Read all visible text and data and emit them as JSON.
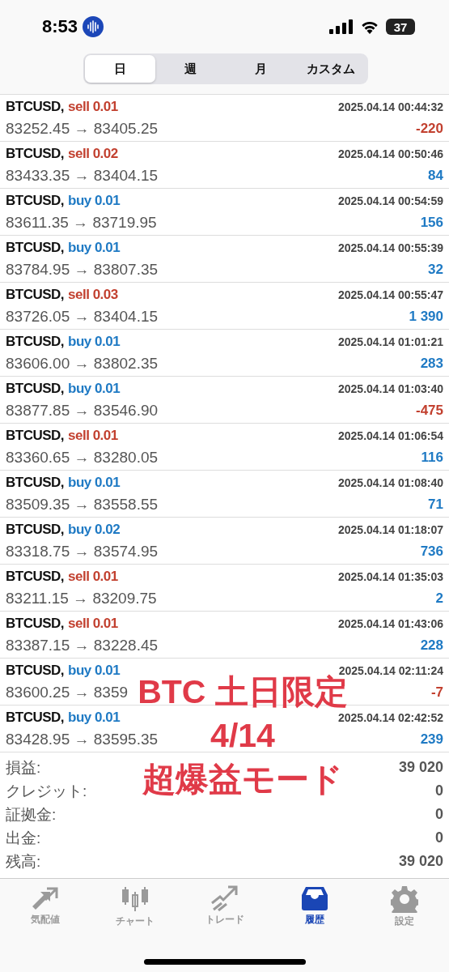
{
  "status_bar": {
    "time": "8:53",
    "battery": "37"
  },
  "period_tabs": [
    {
      "label": "日",
      "selected": true
    },
    {
      "label": "週",
      "selected": false
    },
    {
      "label": "月",
      "selected": false
    },
    {
      "label": "カスタム",
      "selected": false
    }
  ],
  "deals": [
    {
      "symbol": "BTCUSD,",
      "sell": true,
      "order": "sell 0.01",
      "time": "2025.04.14 00:44:32",
      "prices": "83252.45 → 83405.25",
      "loss": true,
      "profit": "-220"
    },
    {
      "symbol": "BTCUSD,",
      "sell": true,
      "order": "sell 0.02",
      "time": "2025.04.14 00:50:46",
      "prices": "83433.35 → 83404.15",
      "loss": false,
      "profit": "84"
    },
    {
      "symbol": "BTCUSD,",
      "sell": false,
      "order": "buy 0.01",
      "time": "2025.04.14 00:54:59",
      "prices": "83611.35 → 83719.95",
      "loss": false,
      "profit": "156"
    },
    {
      "symbol": "BTCUSD,",
      "sell": false,
      "order": "buy 0.01",
      "time": "2025.04.14 00:55:39",
      "prices": "83784.95 → 83807.35",
      "loss": false,
      "profit": "32"
    },
    {
      "symbol": "BTCUSD,",
      "sell": true,
      "order": "sell 0.03",
      "time": "2025.04.14 00:55:47",
      "prices": "83726.05 → 83404.15",
      "loss": false,
      "profit": "1 390"
    },
    {
      "symbol": "BTCUSD,",
      "sell": false,
      "order": "buy 0.01",
      "time": "2025.04.14 01:01:21",
      "prices": "83606.00 → 83802.35",
      "loss": false,
      "profit": "283"
    },
    {
      "symbol": "BTCUSD,",
      "sell": false,
      "order": "buy 0.01",
      "time": "2025.04.14 01:03:40",
      "prices": "83877.85 → 83546.90",
      "loss": true,
      "profit": "-475"
    },
    {
      "symbol": "BTCUSD,",
      "sell": true,
      "order": "sell 0.01",
      "time": "2025.04.14 01:06:54",
      "prices": "83360.65 → 83280.05",
      "loss": false,
      "profit": "116"
    },
    {
      "symbol": "BTCUSD,",
      "sell": false,
      "order": "buy 0.01",
      "time": "2025.04.14 01:08:40",
      "prices": "83509.35 → 83558.55",
      "loss": false,
      "profit": "71"
    },
    {
      "symbol": "BTCUSD,",
      "sell": false,
      "order": "buy 0.02",
      "time": "2025.04.14 01:18:07",
      "prices": "83318.75 → 83574.95",
      "loss": false,
      "profit": "736"
    },
    {
      "symbol": "BTCUSD,",
      "sell": true,
      "order": "sell 0.01",
      "time": "2025.04.14 01:35:03",
      "prices": "83211.15 → 83209.75",
      "loss": false,
      "profit": "2"
    },
    {
      "symbol": "BTCUSD,",
      "sell": true,
      "order": "sell 0.01",
      "time": "2025.04.14 01:43:06",
      "prices": "83387.15 → 83228.45",
      "loss": false,
      "profit": "228"
    },
    {
      "symbol": "BTCUSD,",
      "sell": false,
      "order": "buy 0.01",
      "time": "2025.04.14 02:11:24",
      "prices": "83600.25 → 8359",
      "loss": true,
      "profit": "-7"
    },
    {
      "symbol": "BTCUSD,",
      "sell": false,
      "order": "buy 0.01",
      "time": "2025.04.14 02:42:52",
      "prices": "83428.95 → 83595.35",
      "loss": false,
      "profit": "239"
    }
  ],
  "summary": [
    {
      "label": "損益:",
      "value": "39 020"
    },
    {
      "label": "クレジット:",
      "value": "0"
    },
    {
      "label": "証拠金:",
      "value": "0"
    },
    {
      "label": "出金:",
      "value": "0"
    },
    {
      "label": "残高:",
      "value": "39 020"
    }
  ],
  "overlay_caption": [
    "BTC 土日限定",
    "4/14",
    "超爆益モード"
  ],
  "bottom_tabs": [
    {
      "kind": "quotes",
      "label": "気配値",
      "selected": false
    },
    {
      "kind": "chart",
      "label": "チャート",
      "selected": false
    },
    {
      "kind": "trade",
      "label": "トレード",
      "selected": false
    },
    {
      "kind": "history",
      "label": "履歴",
      "selected": true
    },
    {
      "kind": "settings",
      "label": "設定",
      "selected": false
    }
  ]
}
